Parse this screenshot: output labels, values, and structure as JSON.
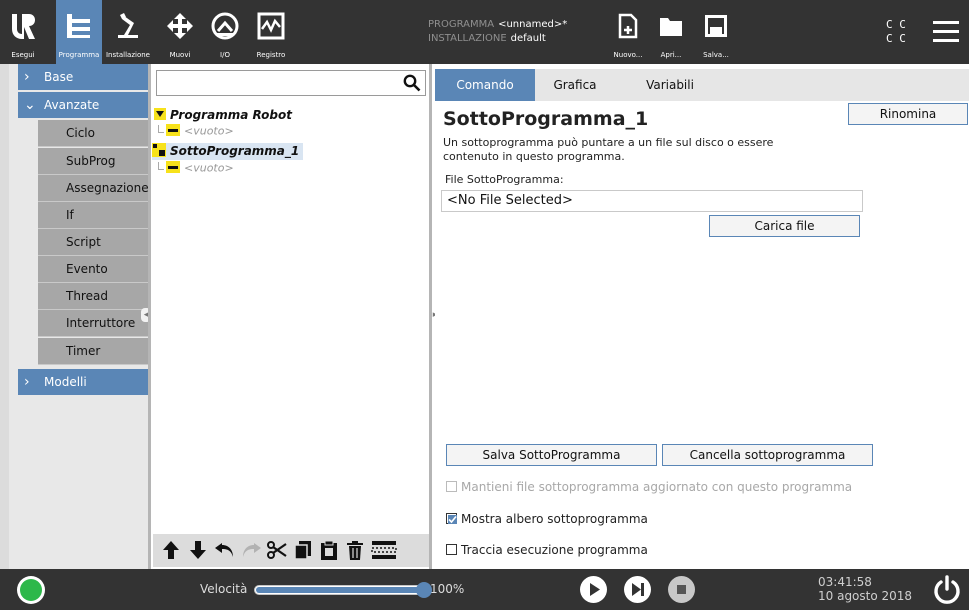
{
  "header": {
    "nav": [
      {
        "label": "Esegui",
        "icon": "ur-logo-icon"
      },
      {
        "label": "Programma",
        "icon": "program-tree-icon"
      },
      {
        "label": "Installazione",
        "icon": "robot-arm-icon"
      },
      {
        "label": "Muovi",
        "icon": "move-arrows-icon"
      },
      {
        "label": "I/O",
        "icon": "io-icon"
      },
      {
        "label": "Registro",
        "icon": "log-chart-icon"
      }
    ],
    "active_nav": "Programma",
    "program_key": "PROGRAMMA",
    "program_value": "<unnamed>*",
    "installation_key": "INSTALLAZIONE",
    "installation_value": "default",
    "file_actions": [
      {
        "label": "Nuovo...",
        "icon": "new-file-icon"
      },
      {
        "label": "Apri...",
        "icon": "open-folder-icon"
      },
      {
        "label": "Salva...",
        "icon": "save-icon"
      }
    ],
    "cc_top": "C C",
    "cc_bottom": "C C",
    "menu_icon": "hamburger-menu-icon"
  },
  "left_panel": {
    "categories": [
      {
        "label": "Base",
        "expanded": false
      },
      {
        "label": "Avanzate",
        "expanded": true
      },
      {
        "label": "Modelli",
        "expanded": false
      }
    ],
    "advanced_items": [
      "Ciclo",
      "SubProg",
      "Assegnazione",
      "If",
      "Script",
      "Evento",
      "Thread",
      "Interruttore",
      "Timer"
    ]
  },
  "tree": {
    "search_placeholder": "",
    "search_icon": "search-icon",
    "nodes": [
      {
        "label": "Programma Robot",
        "type": "root"
      },
      {
        "label": "<vuoto>",
        "type": "empty"
      },
      {
        "label": "SottoProgramma_1",
        "type": "subprogram",
        "selected": true
      },
      {
        "label": "<vuoto>",
        "type": "empty"
      }
    ],
    "toolbar": [
      "move-up-icon",
      "move-down-icon",
      "undo-icon",
      "redo-icon",
      "cut-icon",
      "copy-icon",
      "paste-icon",
      "delete-icon",
      "suppress-icon"
    ]
  },
  "right_panel": {
    "tabs": [
      "Comando",
      "Grafica",
      "Variabili"
    ],
    "active_tab": "Comando",
    "title": "SottoProgramma_1",
    "rename_label": "Rinomina",
    "description": "Un sottoprogramma può puntare a un file sul disco o essere contenuto in questo programma.",
    "file_label": "File SottoProgramma:",
    "file_value": "<No File Selected>",
    "load_label": "Carica file",
    "save_label": "Salva SottoProgramma",
    "clear_label": "Cancella sottoprogramma",
    "checkboxes": [
      {
        "label": "Mantieni file sottoprogramma aggiornato con questo programma",
        "checked": false,
        "enabled": false
      },
      {
        "label": "Mostra albero sottoprogramma",
        "checked": true,
        "enabled": true
      },
      {
        "label": "Traccia esecuzione programma",
        "checked": false,
        "enabled": true
      }
    ]
  },
  "footer": {
    "speed_label": "Velocità",
    "speed_value": "100%",
    "speed_fraction": 1.0,
    "time": "03:41:58",
    "date": "10 agosto 2018",
    "status_color": "#2db84a",
    "accent_color": "#5a86b6"
  }
}
